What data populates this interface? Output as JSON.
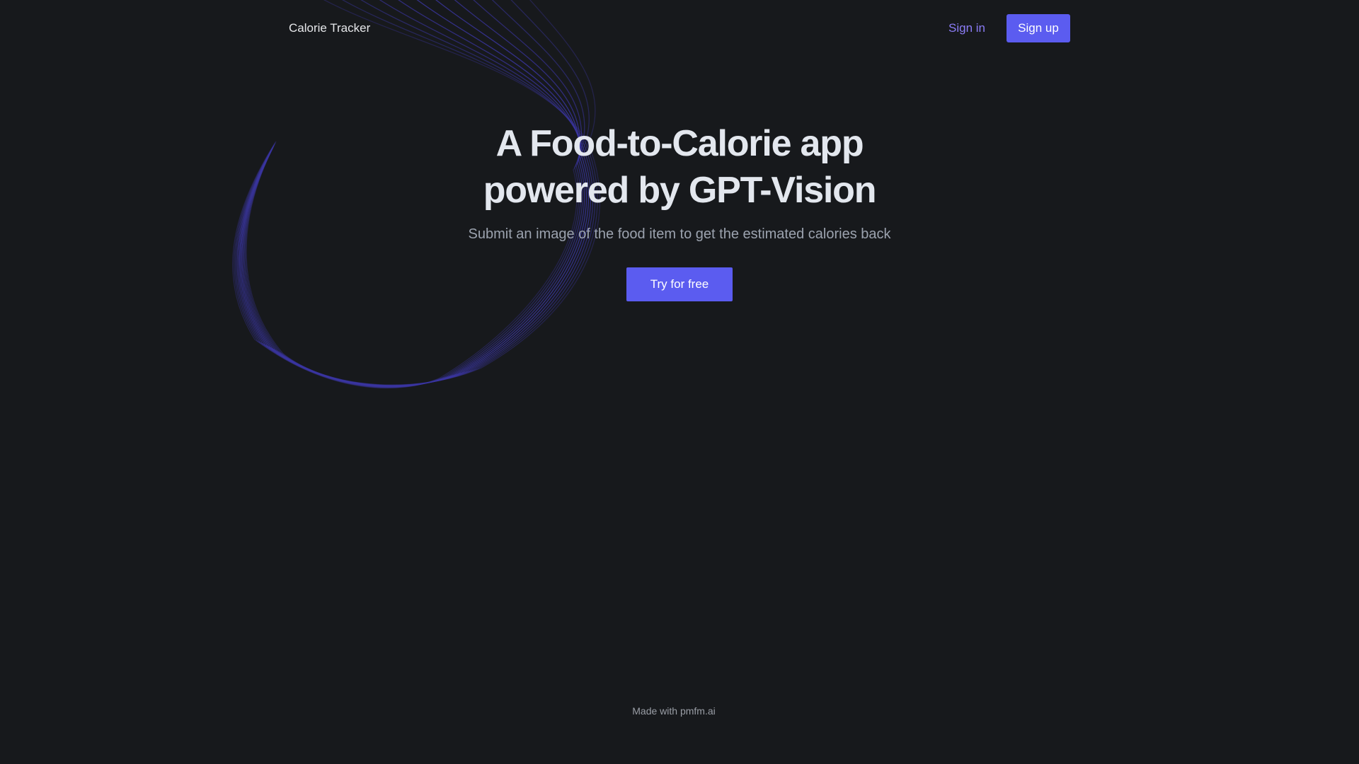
{
  "header": {
    "logo_text": "Calorie Tracker",
    "sign_in_label": "Sign in",
    "sign_up_label": "Sign up"
  },
  "hero": {
    "title_line1": "A Food-to-Calorie app",
    "title_line2": "powered by GPT-Vision",
    "subtitle": "Submit an image of the food item to get the estimated calories back",
    "cta_label": "Try for free"
  },
  "footer": {
    "text": "Made with pmfm.ai"
  },
  "colors": {
    "background": "#17191c",
    "accent": "#5b5cf0",
    "sign_in_link": "#8b7cf6",
    "wave_lines": "#3b36a3"
  }
}
